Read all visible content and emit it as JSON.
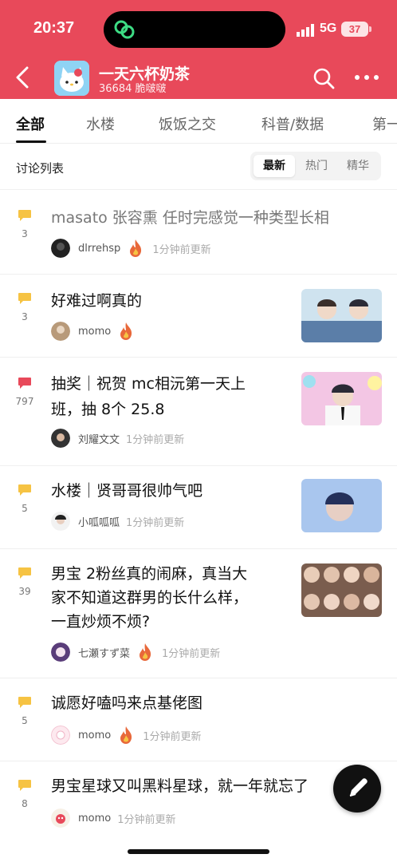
{
  "status_bar": {
    "time": "20:37",
    "network": "5G",
    "battery": "37"
  },
  "header": {
    "title": "一天六杯奶茶",
    "subtitle": "36684 脆啵啵"
  },
  "tabs": [
    {
      "label": "全部"
    },
    {
      "label": "水楼"
    },
    {
      "label": "饭饭之交"
    },
    {
      "label": "科普/数据"
    },
    {
      "label": "第一"
    }
  ],
  "discussion": {
    "title": "讨论列表",
    "sort_options": [
      {
        "label": "最新"
      },
      {
        "label": "热门"
      },
      {
        "label": "精华"
      }
    ]
  },
  "posts": [
    {
      "count": "3",
      "title": "masato 张容熏 任时完感觉一种类型长相",
      "author": "dlrrehsp",
      "updated": "1分钟前更新"
    },
    {
      "count": "3",
      "title": "好难过啊真的",
      "author": "momo",
      "updated": ""
    },
    {
      "count": "797",
      "title_line1": "抽奖｜祝贺 mc相沅第一天上",
      "title_line2": "班，抽 8个 25.8",
      "author": "刘耀文文",
      "updated": "1分钟前更新"
    },
    {
      "count": "5",
      "title": "水楼｜贤哥哥很帅气吧",
      "author": "小呱呱呱",
      "updated": "1分钟前更新"
    },
    {
      "count": "39",
      "title_line1": "男宝 2粉丝真的闹麻，真当大",
      "title_line2": "家不知道这群男的长什么样，",
      "title_line3": "一直炒烦不烦?",
      "author": "七瀬すず菜",
      "updated": "1分钟前更新"
    },
    {
      "count": "5",
      "title": "诚愿好嗑吗来点基佬图",
      "author": "momo",
      "updated": "1分钟前更新"
    },
    {
      "count": "8",
      "title": "男宝星球又叫黑料星球，就一年就忘了",
      "author": "momo",
      "updated": "1分钟前更新"
    }
  ],
  "colors": {
    "brand": "#e8495a",
    "comment_yellow": "#f6c343",
    "comment_red": "#e8495a",
    "flame": "#e8683a"
  }
}
